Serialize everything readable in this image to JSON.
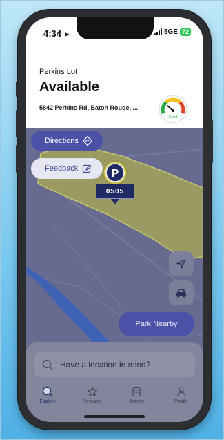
{
  "status_bar": {
    "time": "4:34",
    "network": "5GE",
    "battery": "72"
  },
  "lot": {
    "name": "Perkins Lot",
    "status": "Available",
    "address": "5842 Perkins Rd, Baton Rouge, ...",
    "gauge_label": "Good"
  },
  "map": {
    "directions_label": "Directions",
    "feedback_label": "Feedback",
    "marker_letter": "P",
    "marker_code": "0505",
    "park_nearby_label": "Park Nearby"
  },
  "search": {
    "placeholder": "Have a location in mind?"
  },
  "tabs": [
    {
      "label": "Explore",
      "icon": "search-icon",
      "active": true
    },
    {
      "label": "Rewards",
      "icon": "star-icon",
      "active": false
    },
    {
      "label": "Activity",
      "icon": "document-icon",
      "active": false
    },
    {
      "label": "Profile",
      "icon": "person-icon",
      "active": false
    }
  ],
  "colors": {
    "accent": "#4a52a8",
    "map_overlay": "#676b90",
    "lot_fill": "#9a9a62",
    "river": "#3f63b4"
  }
}
